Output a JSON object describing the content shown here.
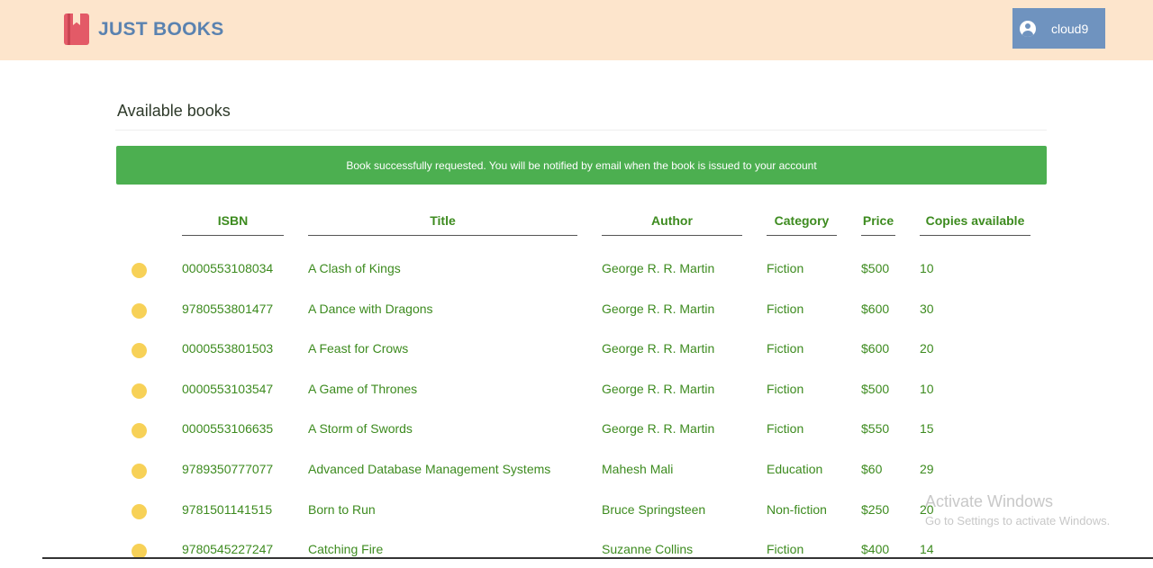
{
  "header": {
    "brand": "JUST BOOKS",
    "user": "cloud9",
    "logo_icon": "book-icon",
    "user_icon": "user-circle-icon"
  },
  "page": {
    "title": "Available books",
    "alert": "Book successfully requested. You will be notified by email when the book is issued to your account"
  },
  "table": {
    "columns": [
      "ISBN",
      "Title",
      "Author",
      "Category",
      "Price",
      "Copies available"
    ],
    "rows": [
      [
        "0000553108034",
        "A Clash of Kings",
        "George R. R. Martin",
        "Fiction",
        "$500",
        "10"
      ],
      [
        "9780553801477",
        "A Dance with Dragons",
        "George R. R. Martin",
        "Fiction",
        "$600",
        "30"
      ],
      [
        "0000553801503",
        "A Feast for Crows",
        "George R. R. Martin",
        "Fiction",
        "$600",
        "20"
      ],
      [
        "0000553103547",
        "A Game of Thrones",
        "George R. R. Martin",
        "Fiction",
        "$500",
        "10"
      ],
      [
        "0000553106635",
        "A Storm of Swords",
        "George R. R. Martin",
        "Fiction",
        "$550",
        "15"
      ],
      [
        "9789350777077",
        "Advanced Database Management Systems",
        "Mahesh Mali",
        "Education",
        "$60",
        "29"
      ],
      [
        "9781501141515",
        "Born to Run",
        "Bruce Springsteen",
        "Non-fiction",
        "$250",
        "20"
      ],
      [
        "9780545227247",
        "Catching Fire",
        "Suzanne Collins",
        "Fiction",
        "$400",
        "14"
      ]
    ]
  },
  "watermark": {
    "title": "Activate Windows",
    "subtitle": "Go to Settings to activate Windows."
  },
  "colors": {
    "header_bg": "#fde5cc",
    "brand": "#5a82b0",
    "user_button": "#6f93bf",
    "alert_bg": "#4caf50",
    "text_green": "#3d8b1f",
    "select_dot": "#f7d157"
  }
}
